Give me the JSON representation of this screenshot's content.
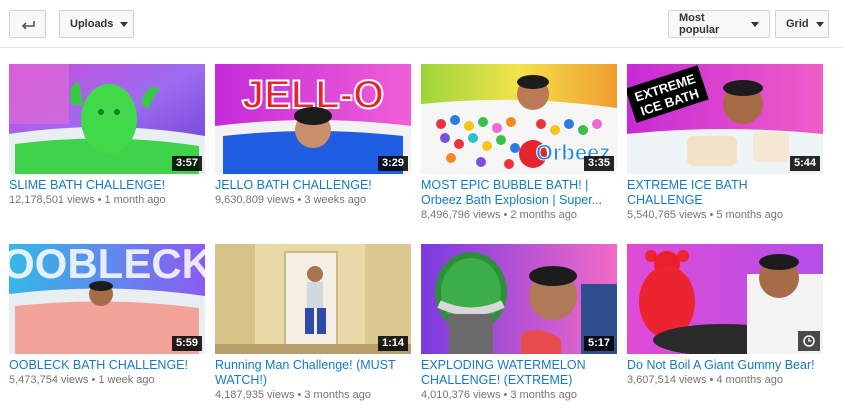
{
  "toolbar": {
    "back_icon": "back-arrow-icon",
    "uploads_label": "Uploads",
    "sort_label": "Most popular",
    "view_label": "Grid"
  },
  "videos": [
    {
      "title": "SLIME BATH CHALLENGE!",
      "views": "12,178,501 views",
      "age": "1 month ago",
      "duration": "3:57"
    },
    {
      "title": "JELLO BATH CHALLENGE!",
      "views": "9,630,809 views",
      "age": "3 weeks ago",
      "duration": "3:29",
      "thumb_text": "JELL-O"
    },
    {
      "title": "MOST EPIC BUBBLE BATH! | Orbeez Bath Explosion | Super...",
      "views": "8,496,796 views",
      "age": "2 months ago",
      "duration": "3:35",
      "thumb_text": "Orbeez"
    },
    {
      "title": "EXTREME ICE BATH CHALLENGE",
      "views": "5,540,765 views",
      "age": "5 months ago",
      "duration": "5:44",
      "thumb_text_1": "EXTREME",
      "thumb_text_2": "ICE BATH"
    },
    {
      "title": "OOBLECK BATH CHALLENGE!",
      "views": "5,473,754 views",
      "age": "1 week ago",
      "duration": "5:59",
      "thumb_text": "OOBLECK"
    },
    {
      "title": "Running Man Challenge! (MUST WATCH!)",
      "views": "4,187,935 views",
      "age": "3 months ago",
      "duration": "1:14"
    },
    {
      "title": "EXPLODING WATERMELON CHALLENGE! (EXTREME)",
      "views": "4,010,376 views",
      "age": "3 months ago",
      "duration": "5:17"
    },
    {
      "title": "Do Not Boil A Giant Gummy Bear!",
      "views": "3,607,514 views",
      "age": "4 months ago",
      "duration_icon": "clock-icon"
    }
  ],
  "colors": {
    "link": "#167ac6",
    "meta": "#767676"
  }
}
